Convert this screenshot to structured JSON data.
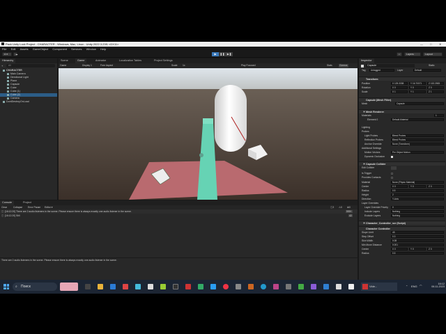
{
  "window": {
    "title": "Pack Unity Lock Project - CHARACTER - Windows, Mac, Linux - Unity 2022.3.23f1 <DX11>",
    "controls": [
      "—",
      "□",
      "✕"
    ]
  },
  "menu": [
    "File",
    "Edit",
    "Assets",
    "GameObject",
    "Component",
    "Services",
    "Window",
    "Help"
  ],
  "toolbar": {
    "account": "A ▾",
    "layers": "Layers",
    "layout": "Layout"
  },
  "hierarchy": {
    "tab": "Hierarchy",
    "search": "All",
    "items": [
      {
        "label": "CHARACTER",
        "level": 0,
        "bold": true
      },
      {
        "label": "Main Camera",
        "level": 1
      },
      {
        "label": "Directional Light",
        "level": 1
      },
      {
        "label": "Plane",
        "level": 1
      },
      {
        "label": "Capsule",
        "level": 1
      },
      {
        "label": "Cube",
        "level": 1
      },
      {
        "label": "Cube (1)",
        "level": 1
      },
      {
        "label": "Cube (2)",
        "level": 1,
        "selected": true
      },
      {
        "label": "Camera",
        "level": 1
      },
      {
        "label": "DontDestroyOnLoad",
        "level": 0
      }
    ]
  },
  "center_tabs": [
    "Scene",
    "Game",
    "Animator",
    "Localization Tables",
    "Project Settings"
  ],
  "game_bar": {
    "display": "Game",
    "display_num": "Display 1",
    "aspect": "Free Aspect",
    "scale": "Scale",
    "scale_val": "1x",
    "play_focused": "Play Focused",
    "stats": "Stats",
    "gizmos": "Gizmos",
    "frame": "Frame: 84 ms"
  },
  "console": {
    "tabs": [
      "Console",
      "Project"
    ],
    "buttons": [
      "Clear",
      "Collapse",
      "Error Pause",
      "Editor ▾"
    ],
    "counts": {
      "info": "2",
      "warn": "0",
      "error": "0"
    },
    "messages": [
      {
        "text": "[16:12:20] There are 2 audio listeners in the scene. Please ensure there is always exactly one audio listener in the scene.",
        "count": "999+"
      },
      {
        "text": "[16:12:20] Still",
        "count": "42"
      }
    ],
    "detail": "There are 2 audio listeners in the scene. Please ensure there is always exactly one audio listener in the scene."
  },
  "status": "Still",
  "inspector": {
    "tab": "Inspector",
    "object_name": "Capsule",
    "static_label": "Static",
    "tag_label": "Tag",
    "tag": "Untagged",
    "layer_label": "Layer",
    "layer": "Default",
    "transform": {
      "title": "Transform",
      "position_label": "Position",
      "position": [
        "X 125.3338",
        "Y 16.70071",
        "Z 152.2583"
      ],
      "rotation_label": "Rotation",
      "rotation": [
        "X 0",
        "Y 0",
        "Z 0"
      ],
      "scale_label": "Scale",
      "scale": [
        "X 1",
        "Y 1",
        "Z 1"
      ]
    },
    "mesh_filter": {
      "title": "Capsule (Mesh Filter)",
      "mesh_label": "Mesh",
      "mesh": "Capsule"
    },
    "mesh_renderer": {
      "title": "Mesh Renderer",
      "materials_label": "Materials",
      "materials_count": "1",
      "element_label": "Element 0",
      "element": "Default-Material",
      "lighting": "Lighting",
      "probes": "Probes",
      "light_probes_label": "Light Probes",
      "light_probes": "Blend Probes",
      "reflection_probes_label": "Reflection Probes",
      "reflection_probes": "Blend Probes",
      "anchor_label": "Anchor Override",
      "anchor": "None (Transform)",
      "additional": "Additional Settings",
      "motion_label": "Motion Vectors",
      "motion": "Per Object Motion",
      "dyn_label": "Dynamic Occlusion"
    },
    "collider": {
      "title": "Capsule Collider",
      "edit_label": "Edit Collider",
      "trigger_label": "Is Trigger",
      "contacts_label": "Provides Contacts",
      "material_label": "Material",
      "material": "None (Physic Material)",
      "center_label": "Center",
      "center": [
        "X 0",
        "Y 0",
        "Z 0"
      ],
      "radius_label": "Radius",
      "radius": "0.5",
      "height_label": "Height",
      "height": "2",
      "direction_label": "Direction",
      "direction": "Y-Axis",
      "overrides": "Layer Overrides",
      "priority_label": "Layer Override Priority",
      "priority": "0",
      "include_label": "Include Layers",
      "include": "Nothing",
      "exclude_label": "Exclude Layers",
      "exclude": "Nothing"
    },
    "script": {
      "title": "Character_Controller_scr (Script)"
    },
    "char_ctrl": {
      "title": "Character Controller",
      "slope_label": "Slope Limit",
      "slope": "45",
      "step_label": "Step Offset",
      "step": "0.3",
      "skin_label": "Skin Width",
      "skin": "0.08",
      "minmove_label": "Min Move Distance",
      "minmove": "0.001",
      "center_label": "Center",
      "center": [
        "X 0",
        "Y 0",
        "Z 0"
      ],
      "radius_label": "Radius",
      "radius": "0.5"
    }
  },
  "taskbar": {
    "search": "Поиск",
    "lang": "ENG",
    "time": "16:12",
    "date": "06.11.2023",
    "app_label": "Vide..."
  },
  "colors": {
    "sky_top": "#d6dde4",
    "ground": "#4a4038",
    "plane": "#b96a6f",
    "walkway": "#66d3b4",
    "selection": "#2c5d87",
    "accent": "#3a79bb"
  }
}
